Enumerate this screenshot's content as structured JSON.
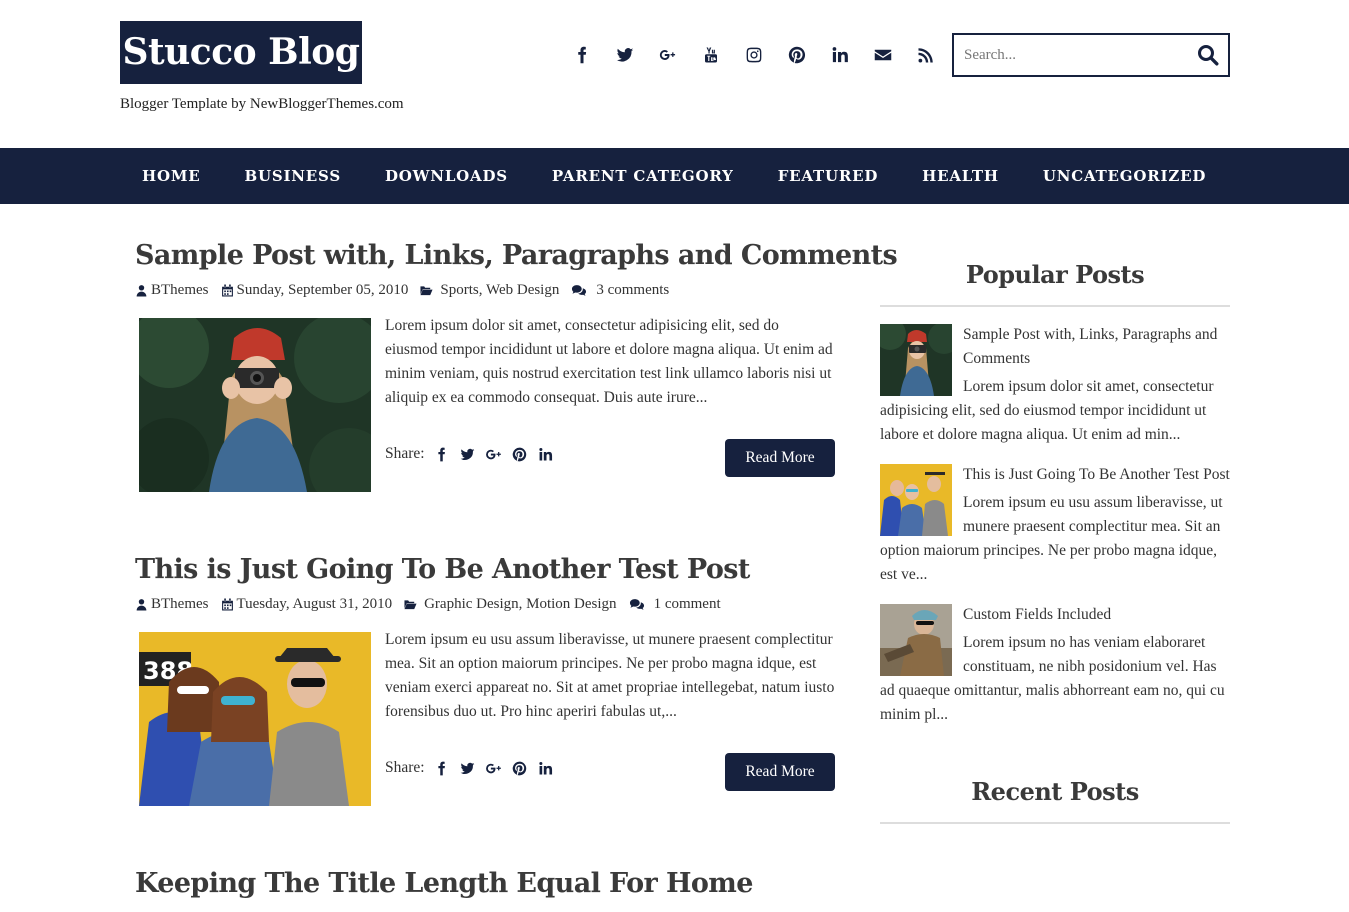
{
  "header": {
    "logo": "Stucco Blog",
    "tagline": "Blogger Template by NewBloggerThemes.com",
    "search_placeholder": "Search..."
  },
  "social_icons": [
    "facebook-icon",
    "twitter-icon",
    "google-plus-icon",
    "youtube-icon",
    "instagram-icon",
    "pinterest-icon",
    "linkedin-icon",
    "email-icon",
    "rss-icon"
  ],
  "nav": {
    "items": [
      "HOME",
      "BUSINESS",
      "DOWNLOADS",
      "PARENT CATEGORY",
      "FEATURED",
      "HEALTH",
      "UNCATEGORIZED"
    ]
  },
  "posts": [
    {
      "title": "Sample Post with, Links, Paragraphs and Comments",
      "author": "BThemes",
      "date": "Sunday, September 05, 2010",
      "categories": "Sports, Web Design",
      "comments": "3 comments",
      "excerpt": "Lorem ipsum dolor sit amet, consectetur adipisicing elit, sed do eiusmod tempor incididunt ut labore et dolore magna aliqua. Ut enim ad minim veniam, quis nostrud exercitation test link ullamco laboris nisi ut aliquip ex ea commodo consequat. Duis aute irure...",
      "share_label": "Share:",
      "read_more": "Read More"
    },
    {
      "title": "This is Just Going To Be Another Test Post",
      "author": "BThemes",
      "date": "Tuesday, August 31, 2010",
      "categories": "Graphic Design, Motion Design",
      "comments": "1 comment",
      "excerpt": "Lorem ipsum eu usu assum liberavisse, ut munere praesent complectitur mea. Sit an option maiorum principes. Ne per probo magna idque, est veniam exerci appareat no. Sit at amet propriae intellegebat, natum iusto forensibus duo ut. Pro hinc aperiri fabulas ut,...",
      "share_label": "Share:",
      "read_more": "Read More"
    },
    {
      "title": "Keeping The Title Length Equal For Home"
    }
  ],
  "sidebar": {
    "popular_title": "Popular Posts",
    "popular": [
      {
        "title": "Sample Post with, Links, Paragraphs and Comments",
        "excerpt": "Lorem ipsum dolor sit amet, consectetur adipisicing elit, sed do eiusmod tempor incididunt ut labore et dolore magna aliqua. Ut enim ad min..."
      },
      {
        "title": "This is Just Going To Be Another Test Post",
        "excerpt": "Lorem ipsum eu usu assum liberavisse, ut munere praesent complectitur mea. Sit an option maiorum principes. Ne per probo magna idque, est ve..."
      },
      {
        "title": "Custom Fields Included",
        "excerpt": "Lorem ipsum no has veniam elaboraret constituam, ne nibh posidonium vel. Has ad quaeque omittantur, malis abhorreant eam no, qui cu minim pl..."
      }
    ],
    "recent_title": "Recent Posts"
  },
  "colors": {
    "navy": "#16213e",
    "text": "#333333",
    "title": "#3a3a3a"
  }
}
